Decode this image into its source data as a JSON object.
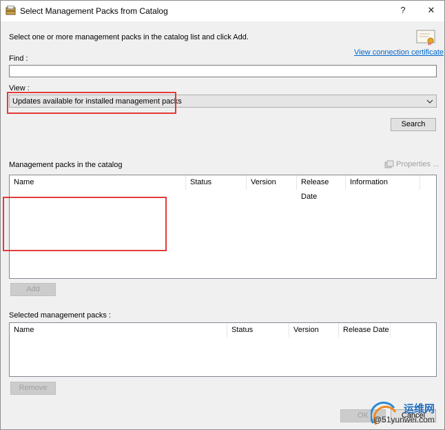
{
  "window": {
    "title": "Select Management Packs from Catalog",
    "help_label": "?",
    "close_label": "✕",
    "app_icon": "catalog-icon"
  },
  "instruction": "Select one or more management packs in the catalog list and click Add.",
  "certificate": {
    "icon": "certificate-icon",
    "link_text": "View connection certificate"
  },
  "find": {
    "label": "Find :",
    "value": ""
  },
  "view": {
    "label": "View :",
    "selected": "Updates available for installed management packs",
    "dropdown_icon": "chevron-down-icon"
  },
  "search_button": "Search",
  "catalog": {
    "label": "Management packs in the catalog",
    "properties_label": "Properties ...",
    "columns": [
      "Name",
      "Status",
      "Version",
      "Release Date",
      "Information"
    ],
    "rows": []
  },
  "add_button": "Add",
  "selected": {
    "label": "Selected management packs :",
    "columns": [
      "Name",
      "Status",
      "Version",
      "Release Date"
    ],
    "rows": []
  },
  "remove_button": "Remove",
  "ok_button": "OK",
  "cancel_button": "Cancel",
  "watermark": {
    "line1": "运维网",
    "line2": "@51yunwei.com"
  },
  "colors": {
    "highlight": "#e23a3a",
    "link": "#0066cc"
  }
}
